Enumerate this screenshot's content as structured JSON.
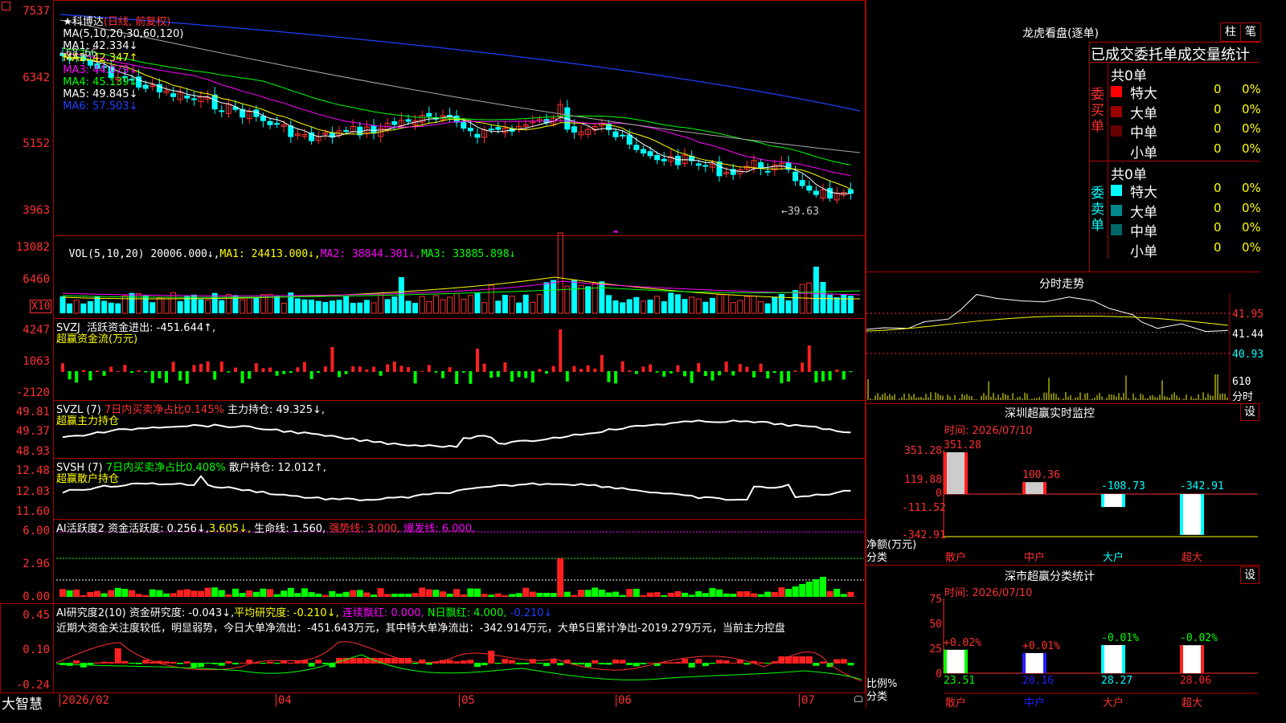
{
  "main_header": {
    "star": "★",
    "name": "科博达",
    "period": "(日线, 前复权)",
    "ma_prefix": "MA(5,10,20,30,60,120)",
    "ma1": "MA1: 42.334↓",
    "ma2": "MA2: 42.347↑",
    "ma3": "MA3: 44.079↓",
    "ma4": "MA4: 45.139↓",
    "ma5": "MA5: 49.845↓",
    "ma6": "MA6: 57.503↓"
  },
  "price_axis": [
    "7537",
    "6342",
    "5152",
    "3963"
  ],
  "price_marks": {
    "high": "68.66",
    "low": "39.63"
  },
  "vol_header": {
    "prefix": "VOL(5,10,20)",
    "val": "20006.000↓,",
    "ma1": "MA1: 24413.000↓,",
    "ma2": "MA2: 38844.301↓,",
    "ma3": "MA3: 33885.898↓"
  },
  "vol_axis": [
    "13082",
    "6460"
  ],
  "vol_unit": "X10",
  "svzj_header": {
    "a": "SVZJ  活跃资金进出: -451.644↑,",
    "b": "超赢资金流(万元)"
  },
  "svzj_axis": [
    "4247",
    "1063",
    "-2120"
  ],
  "svzl_header": {
    "a": "SVZL (7)",
    "b": "7日内买卖净占比0.145%",
    "c": "主力持仓: 49.325↓,",
    "d": "超赢主力持仓"
  },
  "svzl_axis": [
    "49.81",
    "49.37",
    "48.93"
  ],
  "svsh_header": {
    "a": "SVSH (7)",
    "b": "7日内买卖净占比0.408%",
    "c": "散户持仓: 12.012↑,",
    "d": "超赢散户持仓"
  },
  "svsh_axis": [
    "12.48",
    "12.03",
    "11.60"
  ],
  "ai_header": {
    "a": "AI活跃度2",
    "b": "资金活跃度: 0.256↓,",
    "c": "3.605↓,",
    "d": "生命线: 1.560,",
    "e": "强势线: 3.000,",
    "f": "爆发线: 6.000,"
  },
  "ai_axis": [
    "6.00",
    "2.96",
    "0.00"
  ],
  "research_header": {
    "a": "AI研究度2(10)",
    "b": "资金研究度: -0.043↓,",
    "c": "平均研究度: -0.210↓,",
    "d": "连续飘红: 0.000,",
    "e": "N日飘红: 4.000,",
    "f": "-0.210↓"
  },
  "research_text": "近期大资金关注度较低，明显弱势，今日大单净流出：-451.643万元，其中特大单净流出：-342.914万元，大单5日累计净出-2019.279万元，当前主力控盘",
  "research_axis": [
    "0.45",
    "0.10",
    "-0.24"
  ],
  "date_axis": [
    "2026/02",
    "04",
    "05",
    "06",
    "07"
  ],
  "app_name": "大智慧",
  "right": {
    "lhb_title": "龙虎看盘(逐单)",
    "btn_bar": "柱",
    "btn_stroke": "笔",
    "stats_title": "已成交委托单成交量统计",
    "buy_total": "共0单",
    "buy_label": "委买单",
    "sell_total": "共0单",
    "sell_label": "委卖单",
    "buy_rows": [
      {
        "name": "特大",
        "count": "0",
        "pct": "0%",
        "color": "#ff0000"
      },
      {
        "name": "大单",
        "count": "0",
        "pct": "0%",
        "color": "#990000"
      },
      {
        "name": "中单",
        "count": "0",
        "pct": "0%",
        "color": "#660000"
      },
      {
        "name": "小单",
        "count": "0",
        "pct": "0%",
        "color": "#000000"
      }
    ],
    "sell_rows": [
      {
        "name": "特大",
        "count": "0",
        "pct": "0%",
        "color": "#00ffff"
      },
      {
        "name": "大单",
        "count": "0",
        "pct": "0%",
        "color": "#008888"
      },
      {
        "name": "中单",
        "count": "0",
        "pct": "0%",
        "color": "#006666"
      },
      {
        "name": "小单",
        "count": "0",
        "pct": "0%",
        "color": "#000000"
      }
    ],
    "intraday_title": "分时走势",
    "intraday_axis": [
      "41.95",
      "41.44",
      "40.93"
    ],
    "intraday_vol": "610",
    "intraday_label": "分时",
    "monitor_title": "深圳超赢实时监控",
    "monitor_btn": "设",
    "monitor_time": "时间: 2026/07/10",
    "monitor_axis": [
      "351.28",
      "119.88",
      "0",
      "-111.52",
      "-342.91"
    ],
    "monitor_ylabel_a": "净额(万元)",
    "monitor_ylabel_b": "分类",
    "monitor_bars": [
      {
        "cat": "散户",
        "value": 351.28,
        "label": "351.28",
        "cat_color": "#ff3030"
      },
      {
        "cat": "中户",
        "value": 100.36,
        "label": "100.36",
        "cat_color": "#ff3030"
      },
      {
        "cat": "大户",
        "value": -108.73,
        "label": "-108.73",
        "cat_color": "#00ffff"
      },
      {
        "cat": "超大",
        "value": -342.91,
        "label": "-342.91",
        "cat_color": "#ff3030"
      }
    ],
    "class_title": "深市超赢分类统计",
    "class_btn": "设",
    "class_time": "时间: 2026/07/10",
    "class_axis": [
      "75",
      "50",
      "25",
      "0"
    ],
    "class_ylabel_a": "比例%",
    "class_ylabel_b": "分类",
    "class_bars": [
      {
        "cat": "散户",
        "value": 23.51,
        "label": "23.51",
        "delta": "+0.02%",
        "delta_color": "#ff3030",
        "color": "#00ff00"
      },
      {
        "cat": "中户",
        "value": 20.16,
        "label": "20.16",
        "delta": "+0.01%",
        "delta_color": "#ff3030",
        "color": "#2020ff"
      },
      {
        "cat": "大户",
        "value": 28.27,
        "label": "28.27",
        "delta": "-0.01%",
        "delta_color": "#00ff00",
        "color": "#00ffff"
      },
      {
        "cat": "超大",
        "value": 28.06,
        "label": "28.06",
        "delta": "-0.02%",
        "delta_color": "#00ff00",
        "color": "#ff2020"
      }
    ]
  }
}
